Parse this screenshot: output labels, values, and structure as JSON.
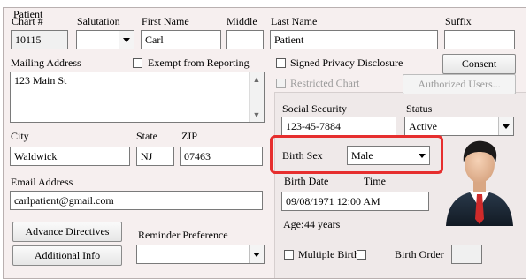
{
  "group_title": "Patient",
  "chart": {
    "label": "Chart #",
    "value": "10115"
  },
  "salutation": {
    "label": "Salutation",
    "value": ""
  },
  "first_name": {
    "label": "First Name",
    "value": "Carl"
  },
  "middle": {
    "label": "Middle",
    "value": ""
  },
  "last_name": {
    "label": "Last Name",
    "value": "Patient"
  },
  "suffix": {
    "label": "Suffix",
    "value": ""
  },
  "mailing_address": {
    "label": "Mailing Address",
    "value": "123 Main St"
  },
  "exempt_reporting": {
    "label": "Exempt from Reporting",
    "checked": false
  },
  "signed_privacy": {
    "label": "Signed Privacy Disclosure",
    "checked": false
  },
  "consent_button": "Consent",
  "restricted_chart": {
    "label": "Restricted Chart",
    "checked": false
  },
  "authorized_users_button": "Authorized Users...",
  "ssn": {
    "label": "Social Security",
    "value": "123-45-7884"
  },
  "status": {
    "label": "Status",
    "value": "Active"
  },
  "city": {
    "label": "City",
    "value": "Waldwick"
  },
  "state": {
    "label": "State",
    "value": "NJ"
  },
  "zip": {
    "label": "ZIP",
    "value": "07463"
  },
  "birth_sex": {
    "label": "Birth Sex",
    "value": "Male"
  },
  "email": {
    "label": "Email Address",
    "value": "carlpatient@gmail.com"
  },
  "birth_date": {
    "label": "Birth Date",
    "time_label": "Time",
    "value": "09/08/1971   12:00 AM"
  },
  "age": {
    "label": "Age:",
    "value": "44 years"
  },
  "advance_directives_button": "Advance Directives",
  "additional_info_button": "Additional Info",
  "reminder_preference": {
    "label": "Reminder Preference",
    "value": ""
  },
  "multiple_birth": {
    "label": "Multiple Birth",
    "checked": false
  },
  "birth_order": {
    "label": "Birth Order",
    "value": ""
  },
  "highlight_color": "#e62e2e"
}
